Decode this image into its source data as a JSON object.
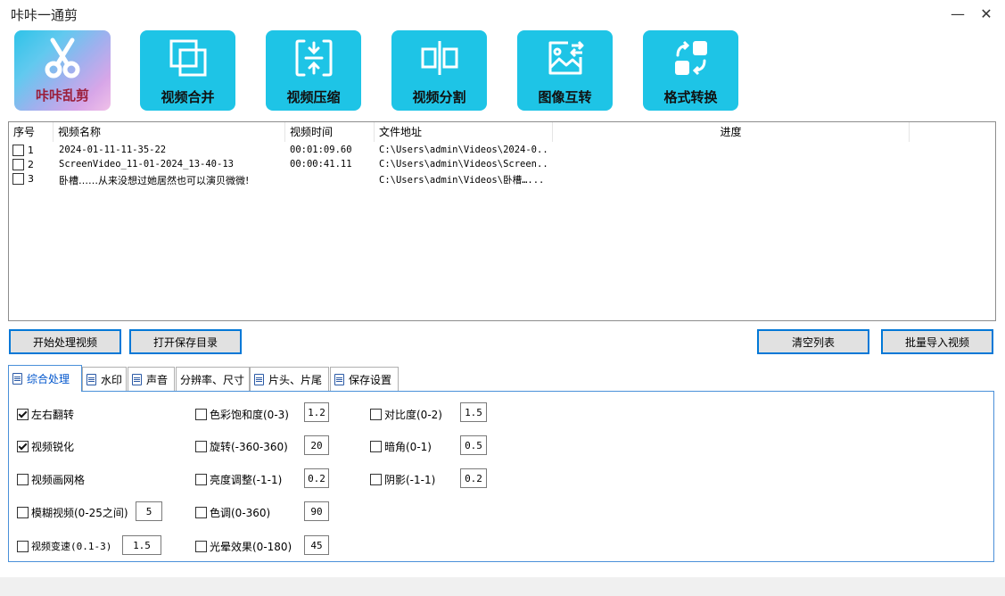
{
  "window": {
    "title": "咔咔一通剪",
    "minimize": "—",
    "close": "✕"
  },
  "toolbar": {
    "logo_label": "咔咔乱剪",
    "buttons": [
      {
        "label": "视频合并",
        "icon": "merge-icon"
      },
      {
        "label": "视频压缩",
        "icon": "compress-icon"
      },
      {
        "label": "视频分割",
        "icon": "split-icon"
      },
      {
        "label": "图像互转",
        "icon": "image-convert-icon"
      },
      {
        "label": "格式转换",
        "icon": "format-convert-icon"
      }
    ]
  },
  "file_list": {
    "columns": [
      "序号",
      "视频名称",
      "视频时间",
      "文件地址",
      "进度"
    ],
    "rows": [
      {
        "index": "1",
        "name": "2024-01-11-11-35-22",
        "duration": "00:01:09.60",
        "path": "C:\\Users\\admin\\Videos\\2024-0...",
        "checked": false
      },
      {
        "index": "2",
        "name": "ScreenVideo_11-01-2024_13-40-13",
        "duration": "00:00:41.11",
        "path": "C:\\Users\\admin\\Videos\\Screen...",
        "checked": false
      },
      {
        "index": "3",
        "name": "卧槽……从来没想过她居然也可以演贝微微!",
        "duration": "",
        "path": "C:\\Users\\admin\\Videos\\卧槽…...",
        "checked": false
      }
    ]
  },
  "actions": {
    "start": "开始处理视频",
    "open_dir": "打开保存目录",
    "clear": "清空列表",
    "import": "批量导入视频"
  },
  "tabs": [
    "综合处理",
    "水印",
    "声音",
    "分辨率、尺寸",
    "片头、片尾",
    "保存设置"
  ],
  "options": {
    "flip": {
      "label": "左右翻转",
      "checked": true
    },
    "sharpen": {
      "label": "视频锐化",
      "checked": true
    },
    "grid": {
      "label": "视频画网格",
      "checked": false
    },
    "blur": {
      "label": "模糊视频(0-25之间)",
      "checked": false,
      "value": "5"
    },
    "speed": {
      "label": "视频变速(0.1-3)",
      "checked": false,
      "value": "1.5"
    },
    "saturation": {
      "label": "色彩饱和度(0-3)",
      "checked": false,
      "value": "1.2"
    },
    "rotate": {
      "label": "旋转(-360-360)",
      "checked": false,
      "value": "20"
    },
    "brightness": {
      "label": "亮度调整(-1-1)",
      "checked": false,
      "value": "0.2"
    },
    "hue": {
      "label": "色调(0-360)",
      "checked": false,
      "value": "90"
    },
    "halo": {
      "label": "光晕效果(0-180)",
      "checked": false,
      "value": "45"
    },
    "contrast": {
      "label": "对比度(0-2)",
      "checked": false,
      "value": "1.5"
    },
    "vignette": {
      "label": "暗角(0-1)",
      "checked": false,
      "value": "0.5"
    },
    "shadow": {
      "label": "阴影(-1-1)",
      "checked": false,
      "value": "0.2"
    }
  },
  "colors": {
    "accent": "#1ec4e6",
    "tab_border": "#4a90d9",
    "button_border": "#0078d7"
  }
}
